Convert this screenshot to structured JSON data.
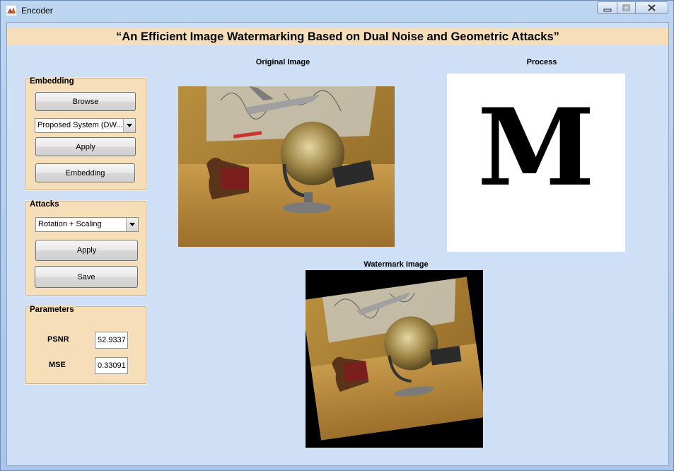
{
  "window": {
    "title": "Encoder"
  },
  "banner": {
    "text": "“An Efficient Image Watermarking Based on Dual Noise and Geometric Attacks”"
  },
  "embedding": {
    "title": "Embedding",
    "browse_label": "Browse",
    "method_selected": "Proposed System (DW...",
    "apply_label": "Apply",
    "embedding_label": "Embedding"
  },
  "attacks": {
    "title": "Attacks",
    "attack_selected": "Rotation + Scaling",
    "apply_label": "Apply",
    "save_label": "Save"
  },
  "parameters": {
    "title": "Parameters",
    "psnr_label": "PSNR",
    "psnr_value": "52.9337",
    "mse_label": "MSE",
    "mse_value": "0.33091"
  },
  "axes": {
    "original_label": "Original Image",
    "process_label": "Process",
    "watermark_label": "Watermark Image",
    "process_glyph": "M"
  }
}
